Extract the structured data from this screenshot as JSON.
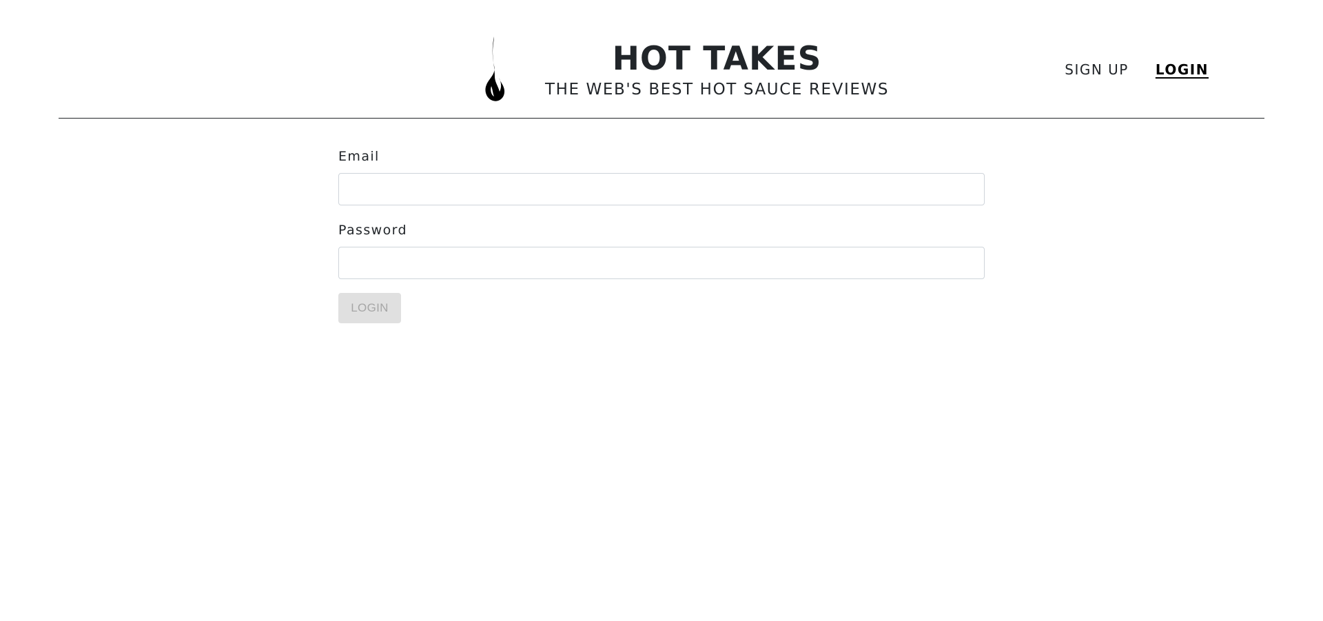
{
  "header": {
    "title": "HOT TAKES",
    "subtitle": "THE WEB'S BEST HOT SAUCE REVIEWS",
    "logo_icon": "flame-icon",
    "nav": {
      "signup_label": "SIGN UP",
      "login_label": "LOGIN",
      "active": "login"
    }
  },
  "form": {
    "email": {
      "label": "Email",
      "value": "",
      "placeholder": ""
    },
    "password": {
      "label": "Password",
      "value": "",
      "placeholder": ""
    },
    "submit_label": "LOGIN",
    "submit_disabled": true
  },
  "colors": {
    "text": "#212529",
    "divider": "#212529",
    "input_border": "#ced4da",
    "button_disabled_bg": "#e0e0e0",
    "button_disabled_text": "#a6a6a6"
  }
}
